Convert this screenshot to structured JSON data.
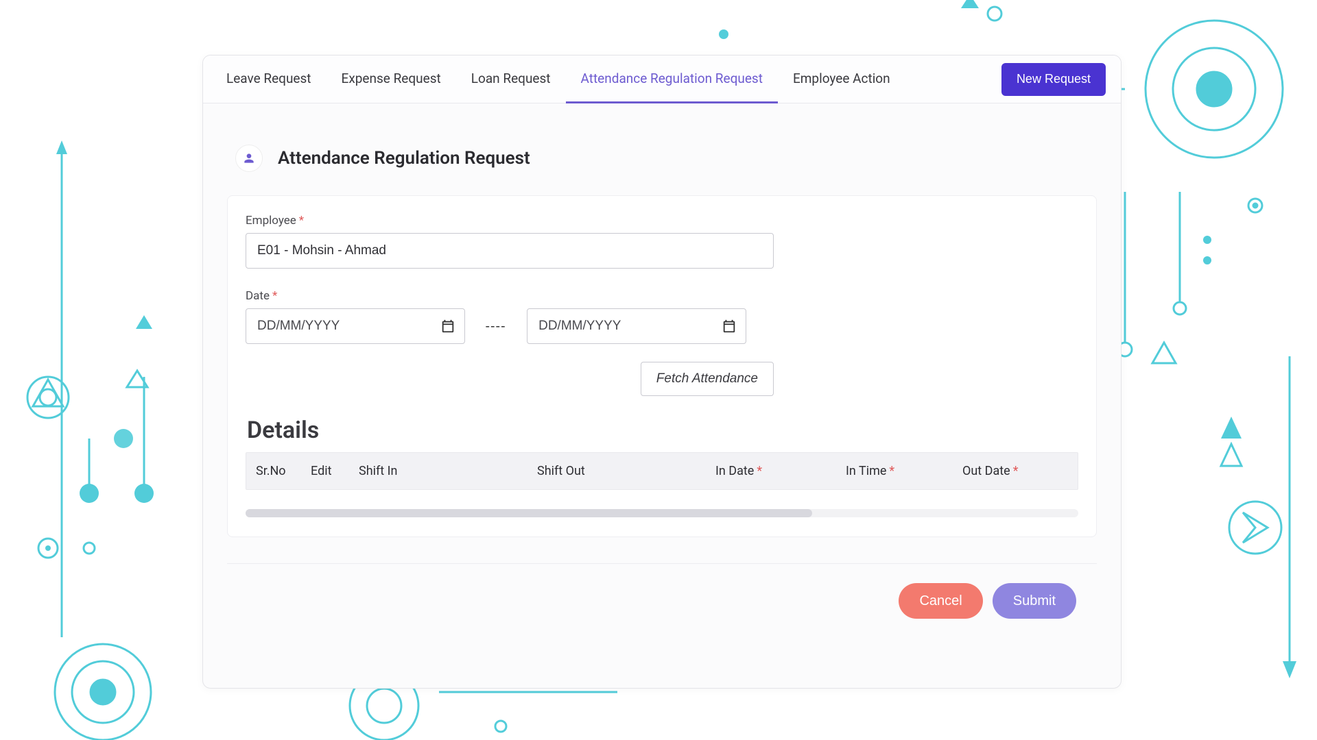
{
  "tabs": {
    "items": [
      {
        "label": "Leave Request",
        "active": false
      },
      {
        "label": "Expense Request",
        "active": false
      },
      {
        "label": "Loan Request",
        "active": false
      },
      {
        "label": "Attendance Regulation Request",
        "active": true
      },
      {
        "label": "Employee Action",
        "active": false
      }
    ],
    "new_request_label": "New Request"
  },
  "section": {
    "title": "Attendance Regulation Request"
  },
  "form": {
    "employee_label": "Employee",
    "employee_value": "E01 - Mohsin - Ahmad",
    "date_label": "Date",
    "date_from_placeholder": "DD/MM/YYYY",
    "date_to_placeholder": "DD/MM/YYYY",
    "date_separator": "----",
    "fetch_label": "Fetch Attendance"
  },
  "details": {
    "title": "Details",
    "columns": {
      "srno": "Sr.No",
      "edit": "Edit",
      "shift_in": "Shift In",
      "shift_out": "Shift Out",
      "in_date": "In Date",
      "in_time": "In Time",
      "out_date": "Out Date"
    }
  },
  "actions": {
    "cancel": "Cancel",
    "submit": "Submit"
  },
  "symbols": {
    "required": "*"
  }
}
